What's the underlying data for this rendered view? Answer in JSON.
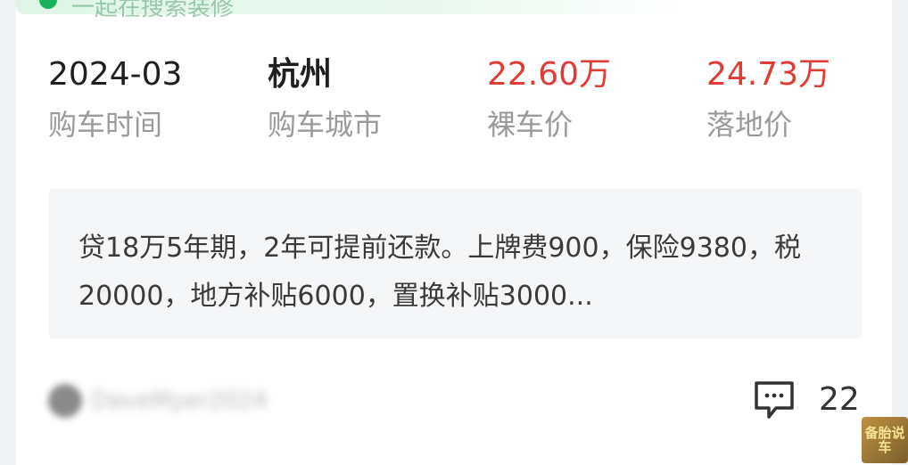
{
  "banner": {
    "text": "一起在搜索装修"
  },
  "stats": [
    {
      "value": "2024-03",
      "label": "购车时间"
    },
    {
      "value": "杭州",
      "label": "购车城市"
    },
    {
      "value": "22.60万",
      "label": "裸车价"
    },
    {
      "value": "24.73万",
      "label": "落地价"
    }
  ],
  "description": "贷18万5年期，2年可提前还款。上牌费900，保险9380，税20000，地方补贴6000，置换补贴3000...",
  "user": {
    "name": "DaveMyer2024"
  },
  "comments": {
    "count": "22"
  },
  "watermark": {
    "text": "备胎说车"
  },
  "colors": {
    "price_red": "#e03c36",
    "label_gray": "#9a9a9a",
    "box_bg": "#f5f6f8"
  }
}
